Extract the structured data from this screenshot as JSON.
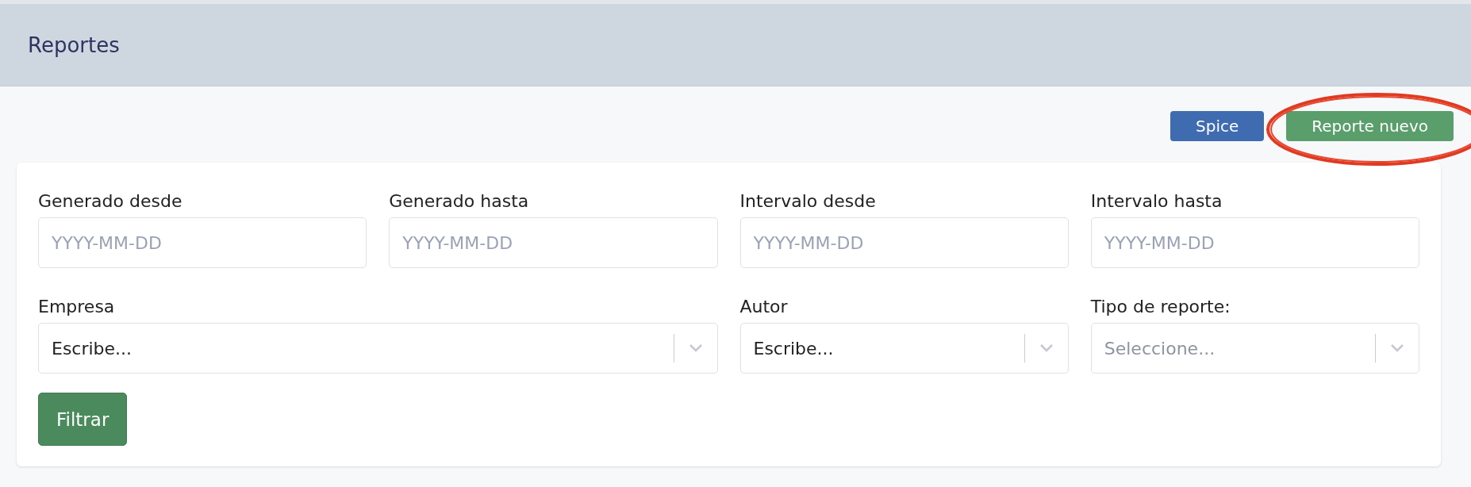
{
  "header": {
    "title": "Reportes"
  },
  "actions": [
    {
      "label": "Spice",
      "kind": "primary",
      "circled": false
    },
    {
      "label": "Reporte nuevo",
      "kind": "success",
      "circled": true
    }
  ],
  "filters": [
    {
      "label": "Generado desde",
      "kind": "date",
      "placeholder": "YYYY-MM-DD"
    },
    {
      "label": "Generado hasta",
      "kind": "date",
      "placeholder": "YYYY-MM-DD"
    },
    {
      "label": "Intervalo desde",
      "kind": "date",
      "placeholder": "YYYY-MM-DD"
    },
    {
      "label": "Intervalo hasta",
      "kind": "date",
      "placeholder": "YYYY-MM-DD"
    },
    {
      "label": "Empresa",
      "kind": "autocomplete",
      "placeholder": "Escribe..."
    },
    {
      "label": "Autor",
      "kind": "autocomplete",
      "placeholder": "Escribe..."
    },
    {
      "label": "Tipo de reporte:",
      "kind": "select",
      "placeholder": "Seleccione..."
    }
  ],
  "submit": {
    "label": "Filtrar"
  }
}
